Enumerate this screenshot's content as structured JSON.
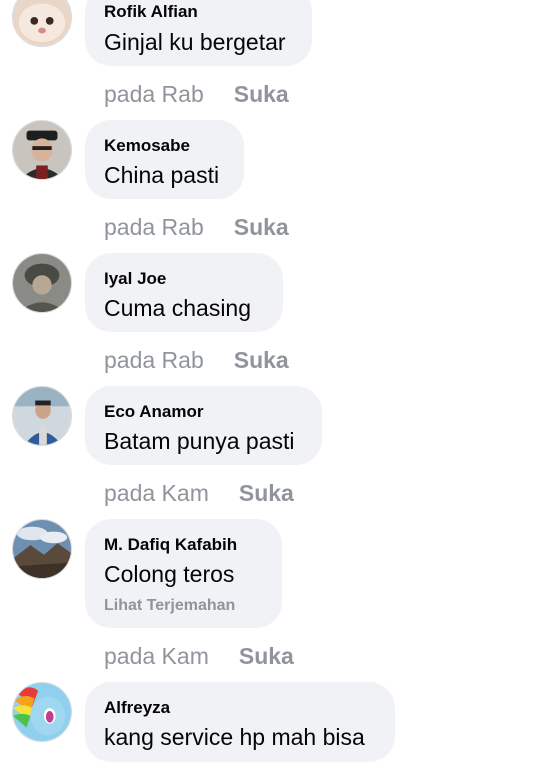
{
  "comments": [
    {
      "author": "Rofik Alfian",
      "text": "Ginjal ku bergetar",
      "time": "pada Rab",
      "like": "Suka",
      "avatar_icon": "cat-avatar-icon"
    },
    {
      "author": "Kemosabe",
      "text": "China pasti",
      "time": "pada Rab",
      "like": "Suka",
      "avatar_icon": "officer-avatar-icon"
    },
    {
      "author": "Iyal Joe",
      "text": "Cuma chasing",
      "time": "pada Rab",
      "like": "Suka",
      "avatar_icon": "soldier-avatar-icon"
    },
    {
      "author": "Eco Anamor",
      "text": "Batam punya pasti",
      "time": "pada Kam",
      "like": "Suka",
      "avatar_icon": "person-avatar-icon"
    },
    {
      "author": "M. Dafiq Kafabih",
      "text": "Colong teros",
      "translate": "Lihat Terjemahan",
      "time": "pada Kam",
      "like": "Suka",
      "avatar_icon": "landscape-avatar-icon"
    },
    {
      "author": "Alfreyza",
      "text": "kang service hp mah bisa",
      "avatar_icon": "pony-avatar-icon"
    }
  ],
  "colors": {
    "bubble": "#f0f2f5",
    "meta_text": "#90949c",
    "text": "#050505"
  }
}
